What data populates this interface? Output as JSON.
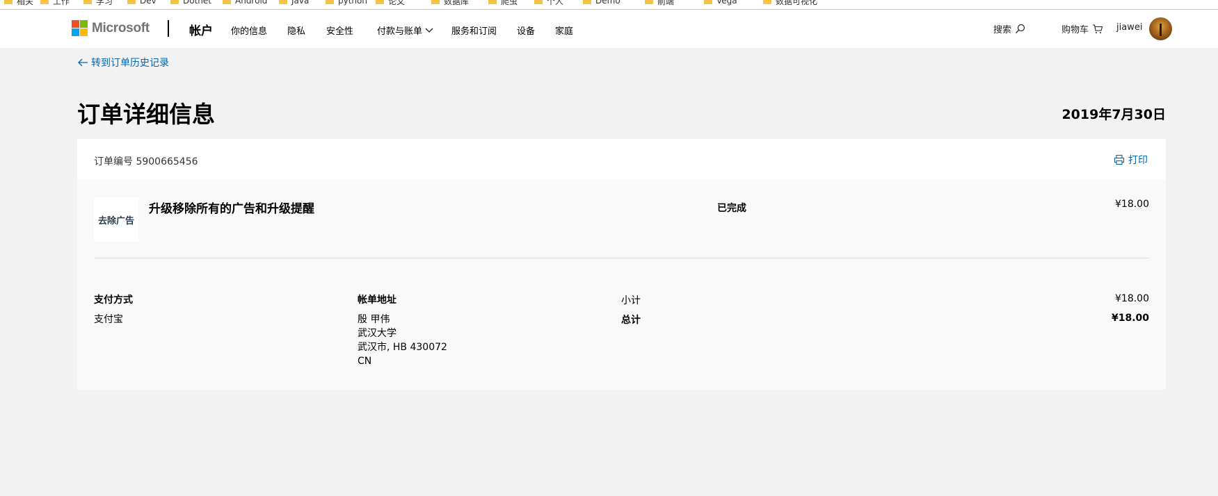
{
  "bookmarks": [
    "相关",
    "工作",
    "学习",
    "Dev",
    "Dotnet",
    "Android",
    "Java",
    "python",
    "论文",
    "数据库",
    "爬虫",
    "个人",
    "Demo",
    "前端",
    "Vega",
    "数据可视化"
  ],
  "header": {
    "brand": "Microsoft",
    "section": "帐户",
    "nav": [
      "你的信息",
      "隐私",
      "安全性",
      "付款与账单",
      "服务和订阅",
      "设备",
      "家庭"
    ],
    "search_label": "搜索",
    "cart_label": "购物车",
    "username": "jiawei"
  },
  "back_link": "转到订单历史记录",
  "page_title": "订单详细信息",
  "order_date": "2019年7月30日",
  "order": {
    "number_label": "订单编号 5900665456",
    "print_label": "打印",
    "item": {
      "thumb_text": "去除广告",
      "name": "升级移除所有的广告和升级提醒",
      "status": "已完成",
      "price": "¥18.00"
    },
    "payment": {
      "label": "支付方式",
      "value": "支付宝"
    },
    "billing": {
      "label": "帐单地址",
      "lines": [
        "殷 甲伟",
        "武汉大学",
        "武汉市, HB 430072",
        "CN"
      ]
    },
    "subtotal": {
      "label": "小计",
      "value": "¥18.00"
    },
    "total": {
      "label": "总计",
      "value": "¥18.00"
    }
  },
  "colors": {
    "accent": "#0067b8",
    "page_bg": "#f2f2f2"
  }
}
